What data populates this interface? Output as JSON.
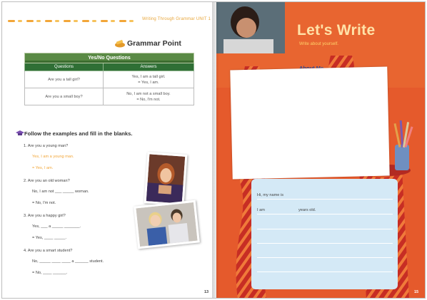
{
  "left_page": {
    "header_text": "Writing Through Grammar UNIT 1",
    "grammar_point_title": "Grammar Point",
    "table": {
      "caption": "Yes/No Questions",
      "headers": [
        "Questions",
        "Answers"
      ],
      "rows": [
        {
          "question": "Are you a tall girl?",
          "answer_line1": "Yes, I am a tall girl.",
          "answer_line2": "= Yes, I am."
        },
        {
          "question": "Are you a small boy?",
          "answer_line1": "No, I am not a small boy.",
          "answer_line2": "= No, I'm not."
        }
      ]
    },
    "exercise_title": "Follow the examples and fill in the blanks.",
    "exercises": [
      {
        "q": "1. Are you a young man?",
        "a1": "Yes, I am a young man.",
        "a2": "= Yes, I am."
      },
      {
        "q": "2. Are you an old woman?",
        "a1": "No, I am not ___ _____ woman.",
        "a2": "= No, I'm not."
      },
      {
        "q": "3. Are you a happy girl?",
        "a1": "Yes, ___ a _____ _______.",
        "a2": "= Yes, ____ _____."
      },
      {
        "q": "4. Are you a smart student?",
        "a1": "No, _____ ____ ____ a ______ student.",
        "a2": "= No, ____ ______."
      }
    ],
    "page_number": "13"
  },
  "right_page": {
    "title": "Let's Write",
    "subtitle": "Write about yourself.",
    "section_label": "About Me",
    "card_line1": "Hi, my name is",
    "card_line2_a": "I am",
    "card_line2_b": "years old.",
    "page_number": "15"
  },
  "colors": {
    "accent_orange": "#f2a638",
    "table_green": "#2f6f35",
    "page_red": "#e8592d",
    "card_blue": "#d4e9f6",
    "title_cream": "#ffe2a8"
  }
}
